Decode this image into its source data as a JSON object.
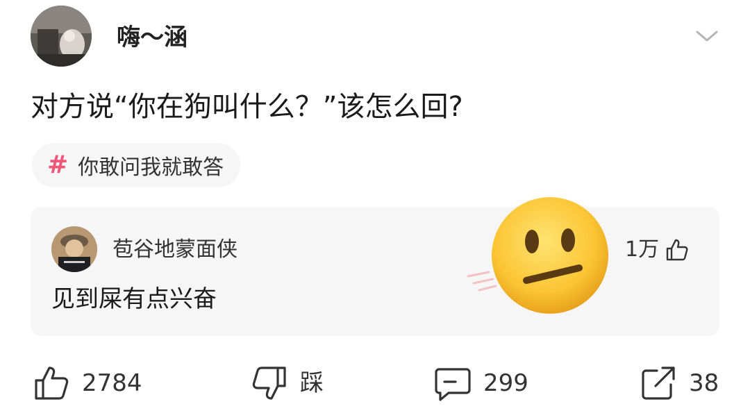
{
  "post": {
    "author_name": "嗨～涵",
    "question": "对方说“你在狗叫什么？”该怎么回?",
    "topic": {
      "hash": "#",
      "label": "你敢问我就敢答"
    }
  },
  "top_comment": {
    "author_name": "苞谷地蒙面侠",
    "text": "见到屎有点兴奋",
    "likes": "1万"
  },
  "actions": {
    "like_count": "2784",
    "dislike_label": "踩",
    "comment_count": "299",
    "share_count": "38"
  },
  "colors": {
    "topic_hash": "#f0557a",
    "card_bg": "#f6f6f6",
    "icon_stroke": "#333333",
    "emoji_face": "#fbc534"
  },
  "icons": {
    "expand": "chevron-down-icon",
    "comment_like": "thumbs-up-outline-icon",
    "like": "thumbs-up-icon",
    "dislike": "thumbs-down-icon",
    "comment": "comment-bubble-icon",
    "share": "share-arrow-icon",
    "sticker": "neutral-face-emoji"
  }
}
